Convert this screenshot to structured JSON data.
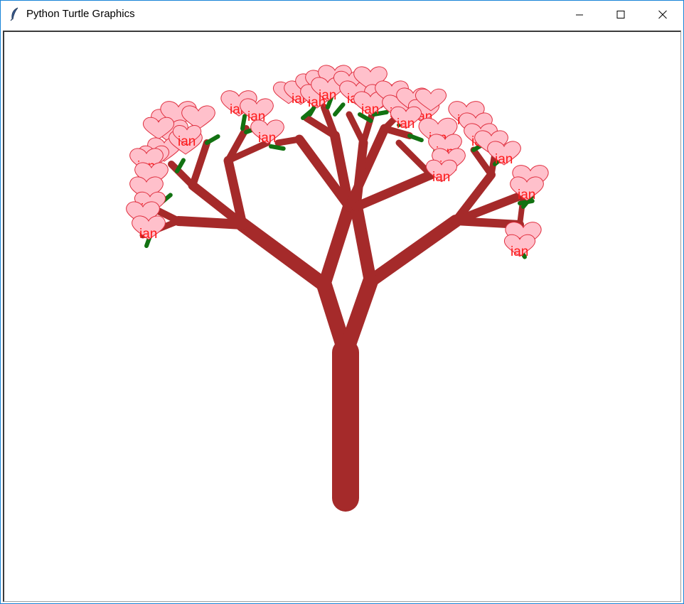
{
  "window": {
    "title": "Python Turtle Graphics",
    "app_icon": "feather-icon",
    "controls": {
      "minimize_icon": "minimize-icon",
      "maximize_icon": "maximize-icon",
      "close_icon": "close-icon"
    }
  },
  "canvas": {
    "background": "#ffffff",
    "trunk_color": "#a52a2a",
    "twig_color": "#127212",
    "heart_fill": "#ffc0cb",
    "heart_stroke": "#e03040",
    "label_color": "#ff1a1a",
    "leaf_label": "ian"
  }
}
